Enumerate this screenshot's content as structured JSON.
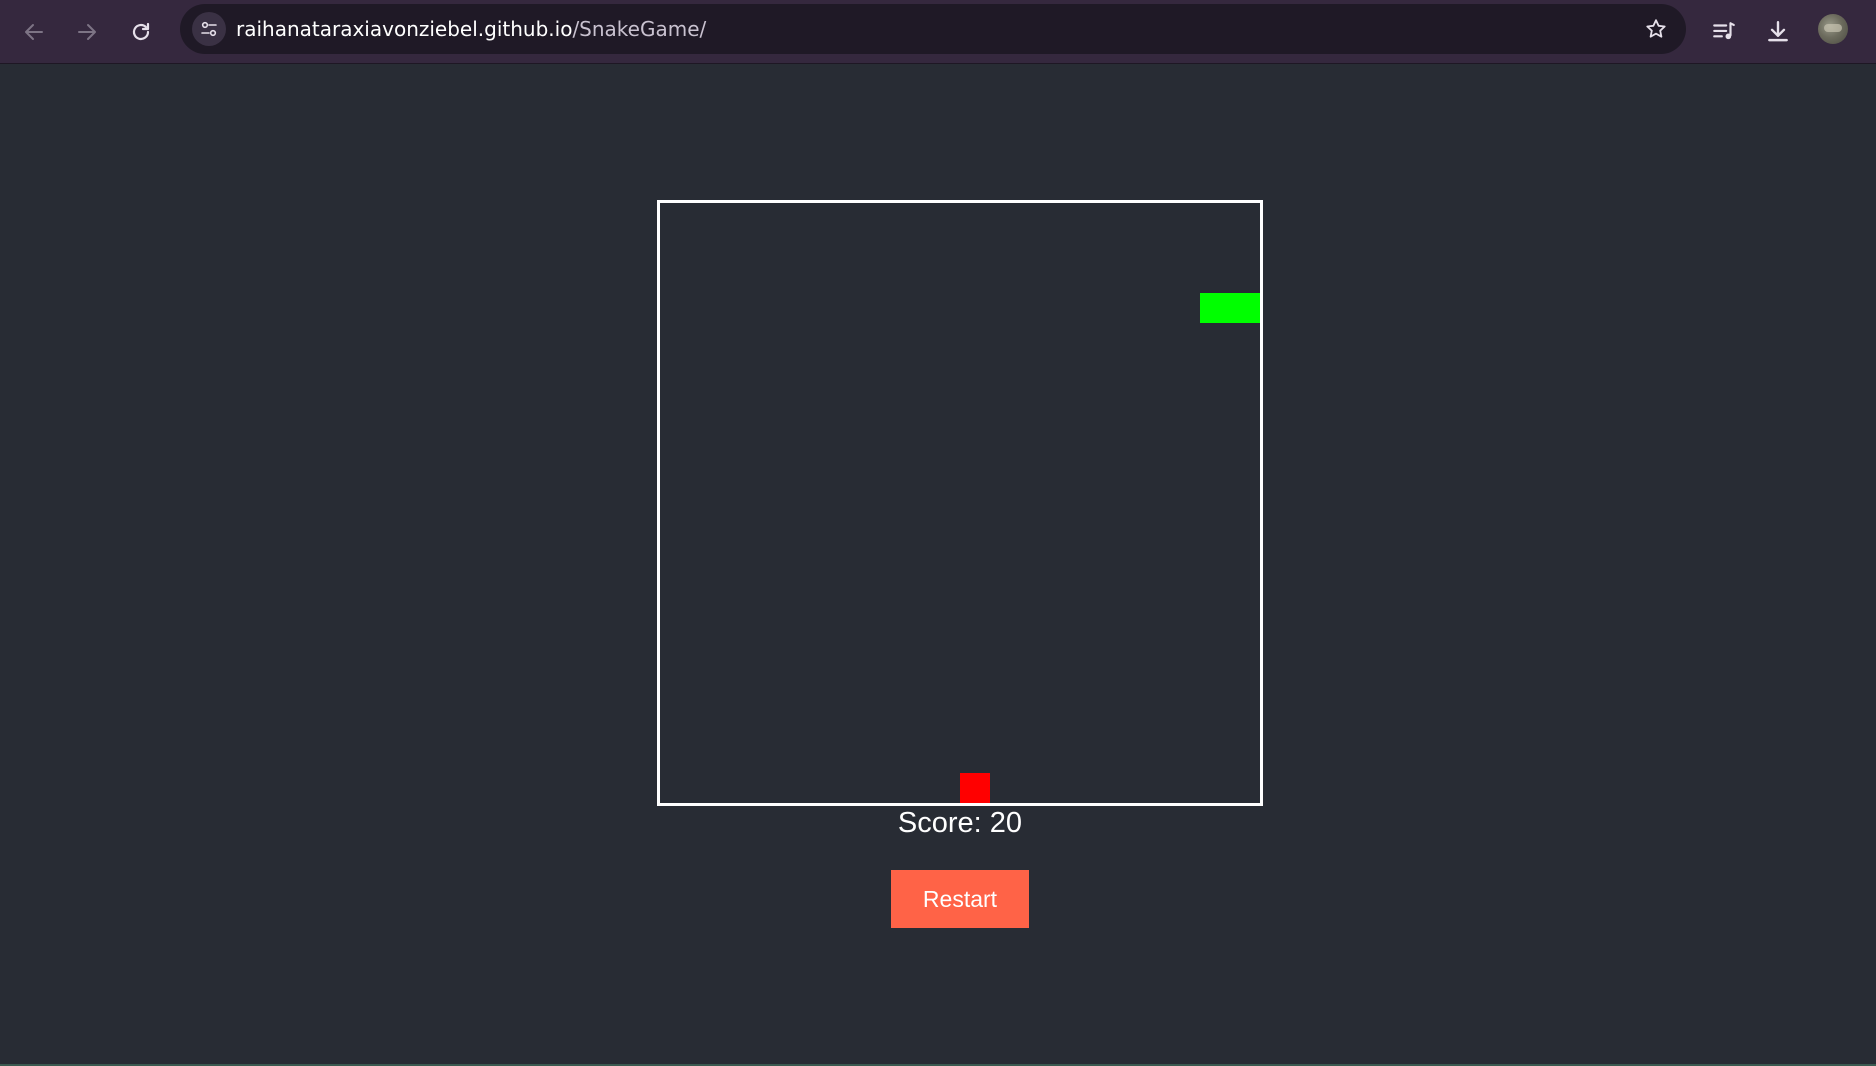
{
  "browser": {
    "url_host": "raihanataraxiavonziebel.github.io",
    "url_path": "/SnakeGame/",
    "icons": {
      "back": "arrow-left-icon",
      "forward": "arrow-right-icon",
      "reload": "reload-icon",
      "site_info": "tune-icon",
      "bookmark": "star-icon",
      "media": "media-queue-icon",
      "download": "download-icon",
      "profile": "avatar"
    }
  },
  "game": {
    "board_cells": 20,
    "snake": [
      {
        "col": 18,
        "row": 3
      },
      {
        "col": 19,
        "row": 3
      }
    ],
    "food": {
      "col": 10,
      "row": 19
    },
    "colors": {
      "background": "#282c34",
      "board_border": "#ffffff",
      "snake": "#00ff00",
      "food": "#ff0000",
      "restart_button": "#ff6347"
    },
    "score_text": "Score: 20",
    "restart_label": "Restart"
  }
}
